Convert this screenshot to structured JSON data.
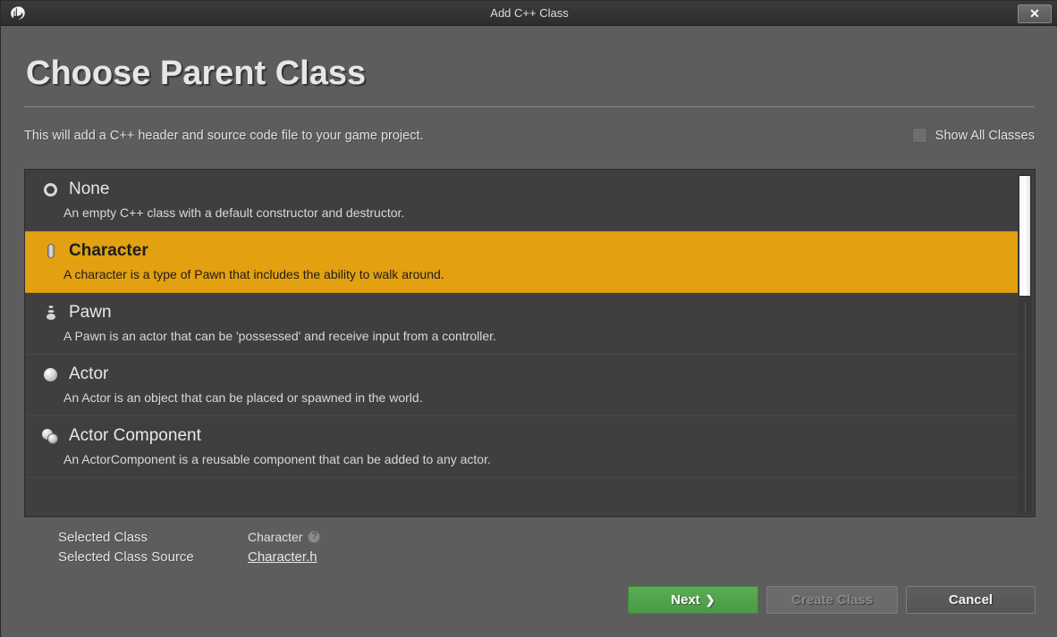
{
  "window": {
    "title": "Add C++ Class",
    "logo_icon": "unreal-engine-logo-icon",
    "close_icon": "close-icon",
    "close_glyph": "✕"
  },
  "header": {
    "title": "Choose Parent Class",
    "subtitle": "This will add a C++ header and source code file to your game project.",
    "show_all_classes_label": "Show All Classes",
    "show_all_classes_checked": false
  },
  "class_list": {
    "items": [
      {
        "name": "None",
        "description": "An empty C++ class with a default constructor and destructor.",
        "icon": "ring-icon",
        "selected": false
      },
      {
        "name": "Character",
        "description": "A character is a type of Pawn that includes the ability to walk around.",
        "icon": "capsule-icon",
        "selected": true
      },
      {
        "name": "Pawn",
        "description": "A Pawn is an actor that can be 'possessed' and receive input from a controller.",
        "icon": "pawn-icon",
        "selected": false
      },
      {
        "name": "Actor",
        "description": "An Actor is an object that can be placed or spawned in the world.",
        "icon": "sphere-icon",
        "selected": false
      },
      {
        "name": "Actor Component",
        "description": "An ActorComponent is a reusable component that can be added to any actor.",
        "icon": "double-sphere-icon",
        "selected": false
      }
    ]
  },
  "selection_info": {
    "selected_class_label": "Selected Class",
    "selected_class_value": "Character",
    "help_icon": "help-icon",
    "help_glyph": "?",
    "selected_class_source_label": "Selected Class Source",
    "selected_class_source_value": "Character.h"
  },
  "footer": {
    "next_label": "Next",
    "next_chevron": "❯",
    "create_class_label": "Create Class",
    "create_class_enabled": false,
    "cancel_label": "Cancel"
  },
  "colors": {
    "dialog_background": "#5d5d5d",
    "titlebar": "#343434",
    "list_background": "#3f3f3f",
    "selection_accent": "#e3a010",
    "next_button": "#4a9a46",
    "text_primary": "#e6e6e6"
  }
}
